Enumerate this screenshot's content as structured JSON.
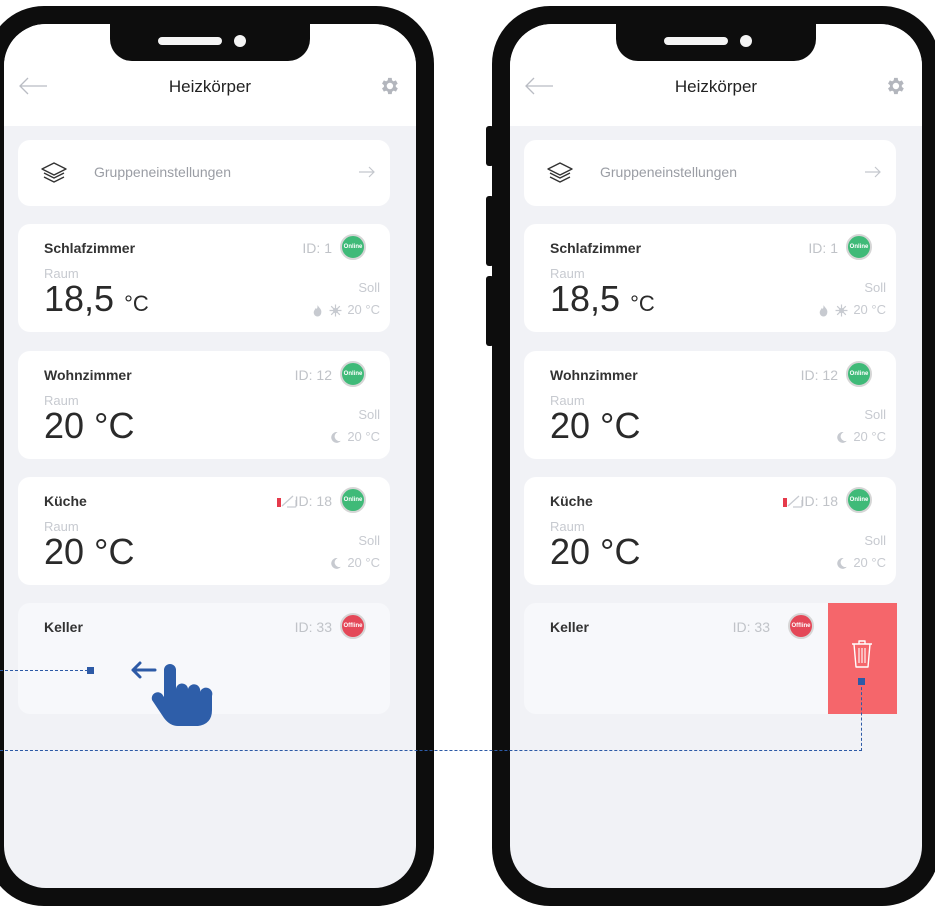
{
  "header": {
    "title": "Heizkörper"
  },
  "group": {
    "label": "Gruppeneinstellungen"
  },
  "rooms": [
    {
      "name": "Schlafzimmer",
      "id": "ID: 1",
      "status": "Online",
      "raum": "Raum",
      "temp": "18,5",
      "unit": "°C",
      "soll": "Soll",
      "set": "20 °C",
      "icons": [
        "flame-icon",
        "sun-icon"
      ]
    },
    {
      "name": "Wohnzimmer",
      "id": "ID: 12",
      "status": "Online",
      "raum": "Raum",
      "temp": "20 °C",
      "unit": "",
      "soll": "Soll",
      "set": "20 °C",
      "icons": [
        "moon-icon"
      ]
    },
    {
      "name": "Küche",
      "id": "ID: 18",
      "status": "Online",
      "raum": "Raum",
      "temp": "20 °C",
      "unit": "",
      "soll": "Soll",
      "set": "20 °C",
      "icons": [
        "moon-icon"
      ]
    },
    {
      "name": "Keller",
      "id": "ID: 33",
      "status": "Offline"
    }
  ],
  "colors": {
    "online": "#3fba78",
    "offline": "#e44858",
    "delete": "#f5666b",
    "guide": "#2d5aa6"
  },
  "gesture": {
    "icons": [
      "swipe-left-arrow-icon",
      "pointing-hand-icon"
    ],
    "action": [
      "trash-icon"
    ]
  }
}
